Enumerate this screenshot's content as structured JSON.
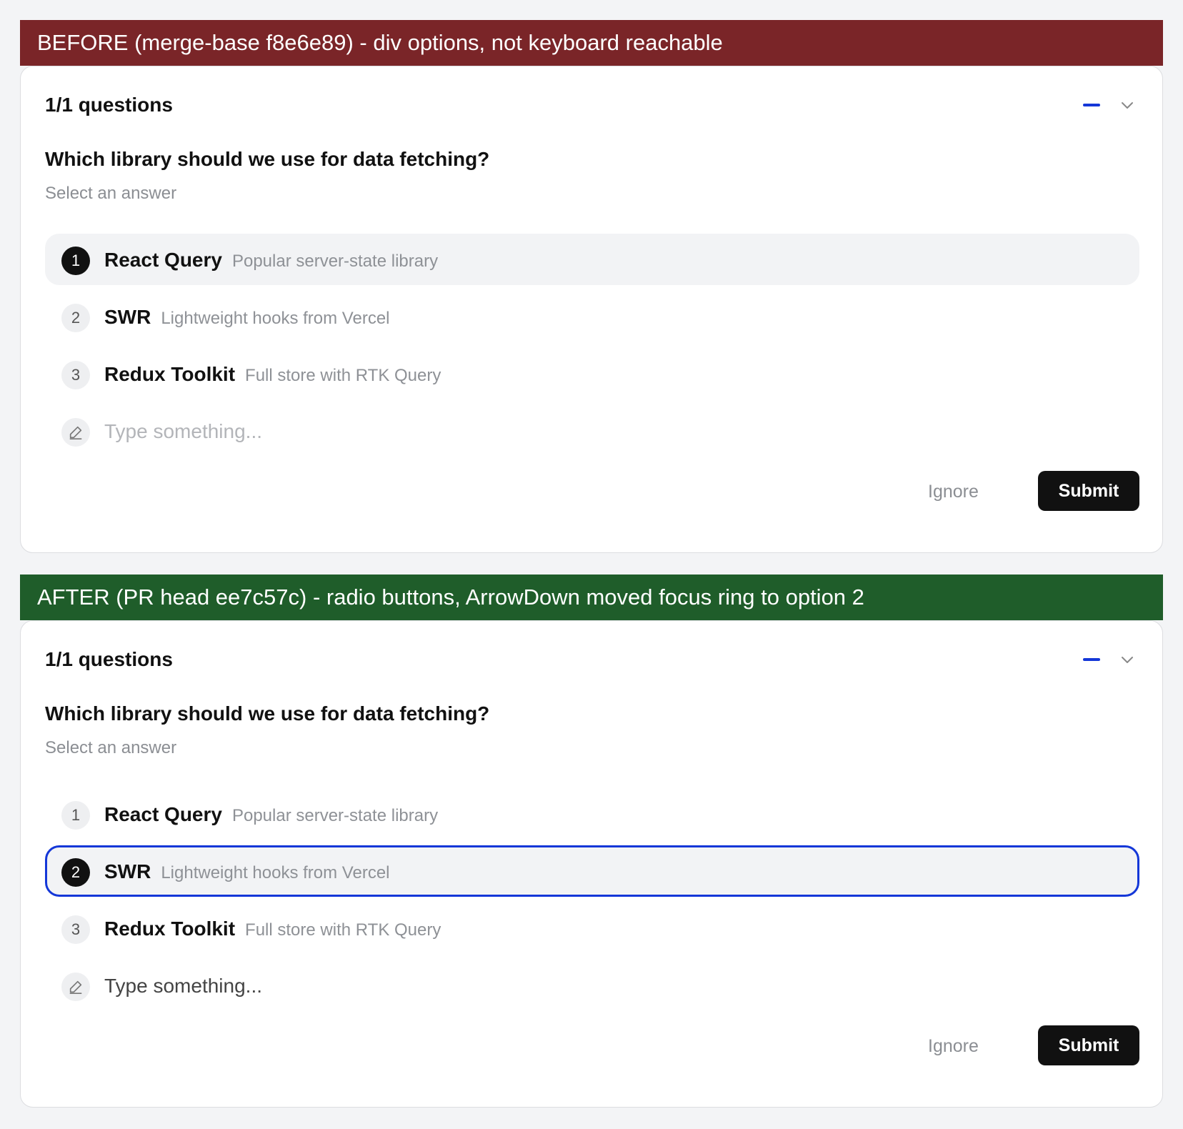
{
  "before": {
    "banner": "BEFORE (merge-base f8e6e89) - div options, not keyboard reachable",
    "banner_color": "#7a2528",
    "header": "1/1 questions",
    "question": "Which library should we use for data fetching?",
    "hint": "Select an answer",
    "options": [
      {
        "num": "1",
        "label": "React Query",
        "desc": "Popular server-state library"
      },
      {
        "num": "2",
        "label": "SWR",
        "desc": "Lightweight hooks from Vercel"
      },
      {
        "num": "3",
        "label": "Redux Toolkit",
        "desc": "Full store with RTK Query"
      }
    ],
    "other_placeholder": "Type something...",
    "ignore_label": "Ignore",
    "submit_label": "Submit"
  },
  "after": {
    "banner": "AFTER (PR head ee7c57c) - radio buttons, ArrowDown moved focus ring to option 2",
    "banner_color": "#1f5d2a",
    "header": "1/1 questions",
    "question": "Which library should we use for data fetching?",
    "hint": "Select an answer",
    "options": [
      {
        "num": "1",
        "label": "React Query",
        "desc": "Popular server-state library"
      },
      {
        "num": "2",
        "label": "SWR",
        "desc": "Lightweight hooks from Vercel"
      },
      {
        "num": "3",
        "label": "Redux Toolkit",
        "desc": "Full store with RTK Query"
      }
    ],
    "other_placeholder": "Type something...",
    "ignore_label": "Ignore",
    "submit_label": "Submit"
  },
  "colors": {
    "accent": "#1437d8",
    "button": "#111111"
  },
  "icons": {
    "collapse": "minus-icon",
    "expand": "chevron-down-icon",
    "other": "pencil-icon"
  }
}
